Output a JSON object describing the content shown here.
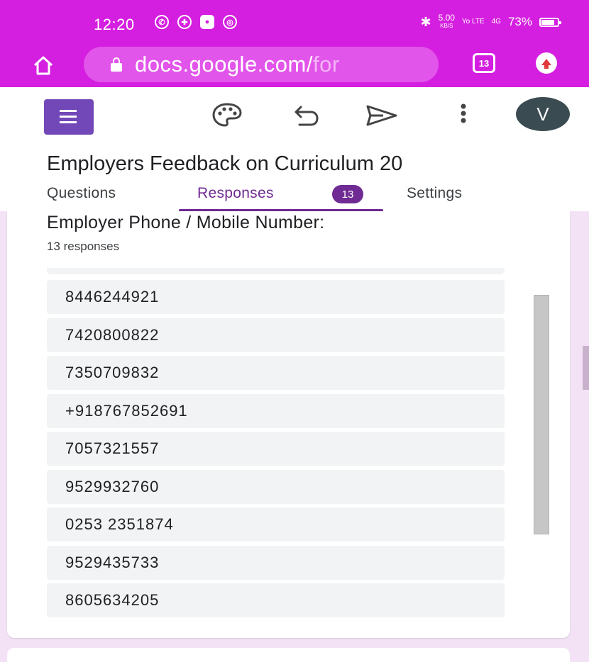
{
  "status_bar": {
    "time": "12:20",
    "speed_value": "5.00",
    "speed_unit": "KB/S",
    "volte": "Yo LTE",
    "network": "4G",
    "battery": "73%"
  },
  "browser": {
    "url_main": "docs.google.com/",
    "url_rest": "for",
    "tab_count": "13"
  },
  "toolbar": {
    "avatar_initial": "V"
  },
  "form": {
    "title": "Employers Feedback on Curriculum 20",
    "tabs": {
      "questions": "Questions",
      "responses": "Responses",
      "responses_count": "13",
      "settings": "Settings"
    }
  },
  "question_card": {
    "title": "Employer Phone / Mobile Number:",
    "response_count": "13 responses",
    "responses": [
      "8446244921",
      "7420800822",
      "7350709832",
      "+918767852691",
      "7057321557",
      "9529932760",
      "0253 2351874",
      "9529435733",
      "8605634205"
    ]
  },
  "colors": {
    "browser_accent": "#d51fe0",
    "forms_purple": "#6f2a93",
    "forms_logo": "#7248b9",
    "page_bg": "#f3e2f6"
  },
  "icons": {
    "status": [
      "whatsapp-icon",
      "app-icon",
      "app-icon",
      "chrome-icon",
      "bluetooth-icon",
      "battery-icon"
    ],
    "browser": [
      "home-icon",
      "lock-icon",
      "tabs-icon",
      "update-icon"
    ],
    "toolbar": [
      "forms-logo-icon",
      "palette-icon",
      "undo-icon",
      "send-icon",
      "more-vert-icon"
    ]
  }
}
